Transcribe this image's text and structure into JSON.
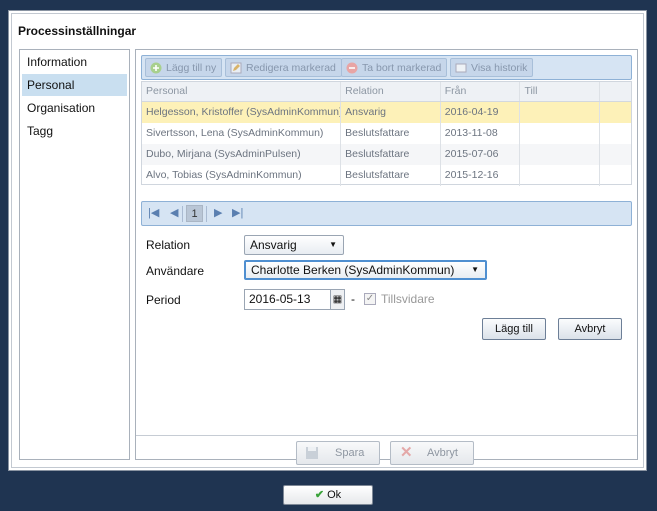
{
  "dialog": {
    "title": "Processinställningar"
  },
  "nav": {
    "items": [
      "Information",
      "Personal",
      "Organisation",
      "Tagg"
    ],
    "active": "Personal"
  },
  "toolbar": {
    "add_label": "Lägg till ny",
    "edit_label": "Redigera markerad",
    "delete_label": "Ta bort markerad",
    "history_label": "Visa historik"
  },
  "grid": {
    "headers": [
      "Personal",
      "Relation",
      "Från",
      "Till"
    ],
    "rows": [
      {
        "personal": "Helgesson, Kristoffer (SysAdminKommun)",
        "relation": "Ansvarig",
        "from": "2016-04-19",
        "to": ""
      },
      {
        "personal": "Sivertsson, Lena (SysAdminKommun)",
        "relation": "Beslutsfattare",
        "from": "2013-11-08",
        "to": ""
      },
      {
        "personal": "Dubo, Mirjana (SysAdminPulsen)",
        "relation": "Beslutsfattare",
        "from": "2015-07-06",
        "to": ""
      },
      {
        "personal": "Alvo, Tobias (SysAdminKommun)",
        "relation": "Beslutsfattare",
        "from": "2015-12-16",
        "to": ""
      }
    ]
  },
  "pager": {
    "page": "1"
  },
  "form": {
    "relation_label": "Relation",
    "relation_value": "Ansvarig",
    "user_label": "Användare",
    "user_value": "Charlotte Berken (SysAdminKommun)",
    "period_label": "Period",
    "period_from": "2016-05-13",
    "period_dash": "-",
    "until_further_label": "Tillsvidare",
    "add_button": "Lägg till",
    "cancel_button": "Avbryt"
  },
  "footer": {
    "save_label": "Spara",
    "cancel_label": "Avbryt"
  },
  "ok_label": "Ok",
  "colors": {
    "accent": "#4f8fd0",
    "selected_row": "#fdf1b8",
    "toolbar_bg": "#d6e4f3",
    "window_bg": "#1f3451"
  }
}
